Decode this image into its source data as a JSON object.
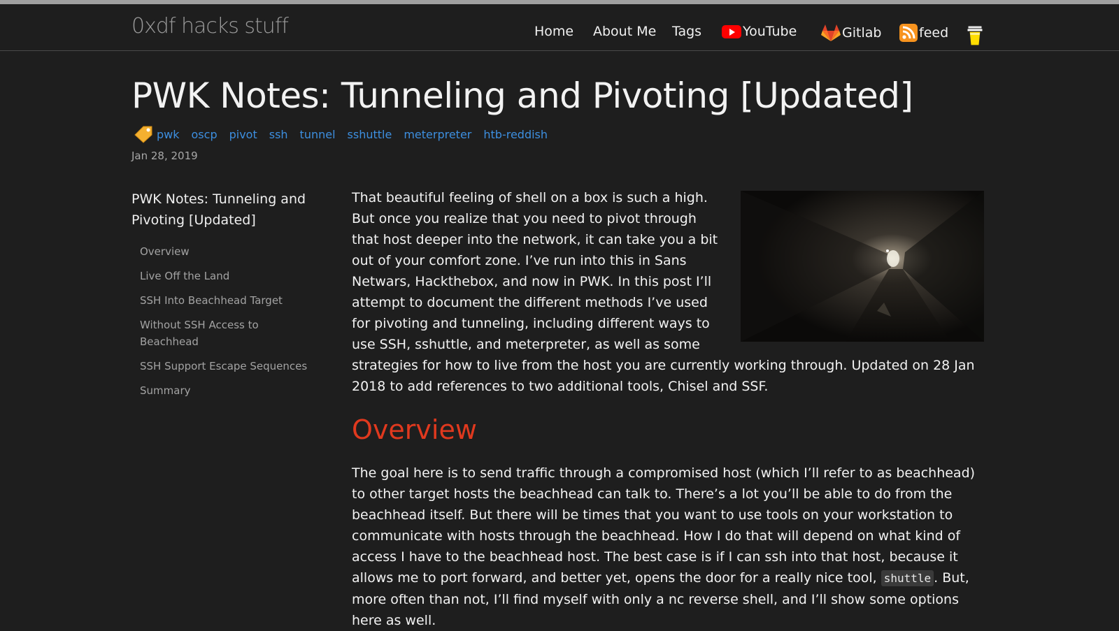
{
  "site": {
    "title": "0xdf hacks stuff"
  },
  "nav": {
    "home": "Home",
    "about": "About Me",
    "tags": "Tags",
    "youtube": "YouTube",
    "gitlab": "Gitlab",
    "feed": "feed"
  },
  "post": {
    "title": "PWK Notes: Tunneling and Pivoting [Updated]",
    "tags": [
      "pwk",
      "oscp",
      "pivot",
      "ssh",
      "tunnel",
      "sshuttle",
      "meterpreter",
      "htb-reddish"
    ],
    "date": "Jan 28, 2019"
  },
  "toc": {
    "title": "PWK Notes: Tunneling and Pivoting [Updated]",
    "items": [
      "Overview",
      "Live Off the Land",
      "SSH Into Beachhead Target",
      "Without SSH Access to Beachhead",
      "SSH Support Escape Sequences",
      "Summary"
    ]
  },
  "content": {
    "intro": "That beautiful feeling of shell on a box is such a high. But once you realize that you need to pivot through that host deeper into the network, it can take you a bit out of your comfort zone. I’ve run into this in Sans Netwars, Hackthebox, and now in PWK. In this post I’ll attempt to document the different methods I’ve used for pivoting and tunneling, including different ways to use SSH, sshuttle, and meterpreter, as well as some strategies for how to live from the host you are currently working through. Updated on 28 Jan 2018 to add references to two additional tools, Chisel and SSF.",
    "overview_heading": "Overview",
    "overview_p1_before": "The goal here is to send traffic through a compromised host (which I’ll refer to as beachhead) to other target hosts the beachhead can talk to. There’s a lot you’ll be able to do from the beachhead itself. But there will be times that you want to use tools on your workstation to communicate with hosts through the beachhead. How I do that will depend on what kind of access I have to the beachhead host. The best case is if I can ssh into that host, because it allows me to port forward, and better yet, opens the door for a really nice tool, ",
    "overview_code": "shuttle",
    "overview_p1_after": ". But, more often than not, I’ll find myself with only a nc reverse shell, and I’ll show some options here as well."
  },
  "colors": {
    "background": "#1e1e1e",
    "link": "#3d8fe0",
    "heading_accent": "#e0391e",
    "youtube": "#ff0000",
    "gitlab": "#fc6d26",
    "rss": "#f7931e"
  }
}
